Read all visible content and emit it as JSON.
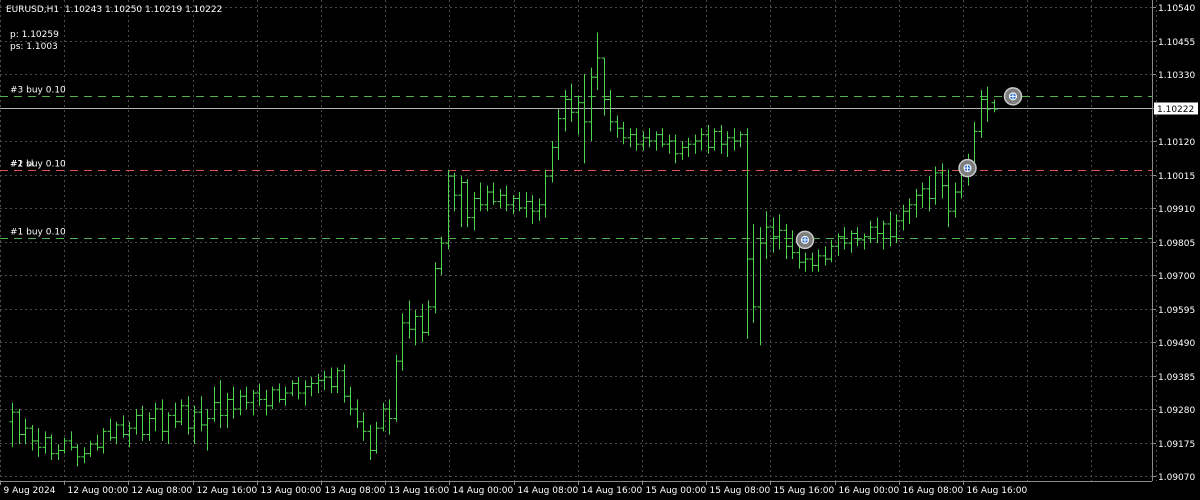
{
  "header": {
    "symbol_timeframe": "EURUSD,H1",
    "ohlc": "1.10243 1.10250 1.10219 1.10222",
    "p_line": "p: 1.10259",
    "ps_line": "ps: 1.1003"
  },
  "price_axis": {
    "labels": [
      "1.10540",
      "1.10455",
      "1.10330",
      "1.10222",
      "1.10120",
      "1.10015",
      "1.09910",
      "1.09805",
      "1.09700",
      "1.09595",
      "1.09490",
      "1.09385",
      "1.09280",
      "1.09175",
      "1.09070"
    ],
    "current_price": "1.10222"
  },
  "time_axis": {
    "labels": [
      "9 Aug 2024",
      "12 Aug 00:00",
      "12 Aug 08:00",
      "12 Aug 16:00",
      "13 Aug 00:00",
      "13 Aug 08:00",
      "13 Aug 16:00",
      "14 Aug 00:00",
      "14 Aug 08:00",
      "14 Aug 16:00",
      "15 Aug 00:00",
      "15 Aug 08:00",
      "15 Aug 16:00",
      "16 Aug 00:00",
      "16 Aug 08:00",
      "16 Aug 16:00"
    ]
  },
  "orders": [
    {
      "label": "#3 buy 0.10",
      "price": 1.1026,
      "color": "#4fb24f"
    },
    {
      "label": "#2 buy 0.10",
      "price": 1.1003,
      "color": "#d9534f"
    },
    {
      "label": "#1 buy 0.10",
      "price": 1.09815,
      "color": "#4fb24f"
    }
  ],
  "order_overlap_label": "#1 sl",
  "bid_line_color": "#b0b0b0",
  "colors": {
    "background": "#000000",
    "grid": "#4a4a4a",
    "bar": "#4fd64f",
    "text": "#ffffff",
    "price_tag_bg": "#ffffff",
    "price_tag_text": "#000000"
  },
  "chart_data": {
    "type": "ohlc",
    "symbol": "EURUSD",
    "timeframe": "H1",
    "ylim": [
      1.0907,
      1.1054
    ],
    "grid": true,
    "entries": [
      {
        "time_index": 122,
        "price": 1.0981
      },
      {
        "time_index": 147,
        "price": 1.10035
      },
      {
        "time_index": 154,
        "price": 1.1026
      }
    ],
    "bars": [
      {
        "o": 1.0924,
        "h": 1.093,
        "l": 1.0916,
        "c": 1.0927
      },
      {
        "o": 1.0927,
        "h": 1.0928,
        "l": 1.0917,
        "c": 1.092
      },
      {
        "o": 1.092,
        "h": 1.0925,
        "l": 1.0917,
        "c": 1.0922
      },
      {
        "o": 1.0922,
        "h": 1.0923,
        "l": 1.0915,
        "c": 1.0918
      },
      {
        "o": 1.0918,
        "h": 1.0922,
        "l": 1.0913,
        "c": 1.0916
      },
      {
        "o": 1.0916,
        "h": 1.0921,
        "l": 1.0914,
        "c": 1.0919
      },
      {
        "o": 1.0919,
        "h": 1.092,
        "l": 1.0912,
        "c": 1.0914
      },
      {
        "o": 1.0914,
        "h": 1.0917,
        "l": 1.0912,
        "c": 1.0915
      },
      {
        "o": 1.0915,
        "h": 1.0919,
        "l": 1.0914,
        "c": 1.0918
      },
      {
        "o": 1.0918,
        "h": 1.0921,
        "l": 1.0915,
        "c": 1.0916
      },
      {
        "o": 1.0916,
        "h": 1.0917,
        "l": 1.091,
        "c": 1.0913
      },
      {
        "o": 1.0913,
        "h": 1.0916,
        "l": 1.0911,
        "c": 1.0914
      },
      {
        "o": 1.0914,
        "h": 1.0918,
        "l": 1.0913,
        "c": 1.0917
      },
      {
        "o": 1.0917,
        "h": 1.092,
        "l": 1.0915,
        "c": 1.0916
      },
      {
        "o": 1.0916,
        "h": 1.0922,
        "l": 1.0914,
        "c": 1.0921
      },
      {
        "o": 1.0921,
        "h": 1.0925,
        "l": 1.0918,
        "c": 1.0919
      },
      {
        "o": 1.0919,
        "h": 1.0924,
        "l": 1.0917,
        "c": 1.0923
      },
      {
        "o": 1.0923,
        "h": 1.0926,
        "l": 1.0919,
        "c": 1.092
      },
      {
        "o": 1.092,
        "h": 1.0924,
        "l": 1.0916,
        "c": 1.0922
      },
      {
        "o": 1.0922,
        "h": 1.0928,
        "l": 1.092,
        "c": 1.0926
      },
      {
        "o": 1.0926,
        "h": 1.0929,
        "l": 1.0918,
        "c": 1.092
      },
      {
        "o": 1.092,
        "h": 1.0927,
        "l": 1.0918,
        "c": 1.0925
      },
      {
        "o": 1.0925,
        "h": 1.093,
        "l": 1.0921,
        "c": 1.0928
      },
      {
        "o": 1.0928,
        "h": 1.0931,
        "l": 1.0918,
        "c": 1.0921
      },
      {
        "o": 1.0921,
        "h": 1.0927,
        "l": 1.0917,
        "c": 1.0926
      },
      {
        "o": 1.0926,
        "h": 1.093,
        "l": 1.0922,
        "c": 1.0924
      },
      {
        "o": 1.0924,
        "h": 1.0931,
        "l": 1.0923,
        "c": 1.0929
      },
      {
        "o": 1.0929,
        "h": 1.0932,
        "l": 1.092,
        "c": 1.0922
      },
      {
        "o": 1.0922,
        "h": 1.0929,
        "l": 1.0917,
        "c": 1.0927
      },
      {
        "o": 1.0927,
        "h": 1.0932,
        "l": 1.0921,
        "c": 1.0923
      },
      {
        "o": 1.0923,
        "h": 1.0928,
        "l": 1.0915,
        "c": 1.0925
      },
      {
        "o": 1.0925,
        "h": 1.0935,
        "l": 1.0924,
        "c": 1.093
      },
      {
        "o": 1.093,
        "h": 1.0937,
        "l": 1.0922,
        "c": 1.0926
      },
      {
        "o": 1.0926,
        "h": 1.0933,
        "l": 1.0922,
        "c": 1.0931
      },
      {
        "o": 1.0931,
        "h": 1.0935,
        "l": 1.0925,
        "c": 1.0928
      },
      {
        "o": 1.0928,
        "h": 1.0934,
        "l": 1.0926,
        "c": 1.0932
      },
      {
        "o": 1.0932,
        "h": 1.0935,
        "l": 1.0928,
        "c": 1.093
      },
      {
        "o": 1.093,
        "h": 1.0934,
        "l": 1.0926,
        "c": 1.0933
      },
      {
        "o": 1.0933,
        "h": 1.0936,
        "l": 1.0929,
        "c": 1.0931
      },
      {
        "o": 1.0931,
        "h": 1.0934,
        "l": 1.0926,
        "c": 1.0929
      },
      {
        "o": 1.0929,
        "h": 1.0935,
        "l": 1.0928,
        "c": 1.0934
      },
      {
        "o": 1.0934,
        "h": 1.0936,
        "l": 1.093,
        "c": 1.0931
      },
      {
        "o": 1.0931,
        "h": 1.0935,
        "l": 1.0929,
        "c": 1.0933
      },
      {
        "o": 1.0933,
        "h": 1.0937,
        "l": 1.0932,
        "c": 1.0936
      },
      {
        "o": 1.0936,
        "h": 1.0938,
        "l": 1.0931,
        "c": 1.0933
      },
      {
        "o": 1.0933,
        "h": 1.0937,
        "l": 1.0929,
        "c": 1.0935
      },
      {
        "o": 1.0935,
        "h": 1.0938,
        "l": 1.0932,
        "c": 1.0936
      },
      {
        "o": 1.0936,
        "h": 1.0939,
        "l": 1.0933,
        "c": 1.0937
      },
      {
        "o": 1.0937,
        "h": 1.094,
        "l": 1.0934,
        "c": 1.0938
      },
      {
        "o": 1.0938,
        "h": 1.0941,
        "l": 1.0933,
        "c": 1.0935
      },
      {
        "o": 1.0935,
        "h": 1.0941,
        "l": 1.0933,
        "c": 1.094
      },
      {
        "o": 1.094,
        "h": 1.0942,
        "l": 1.093,
        "c": 1.0932
      },
      {
        "o": 1.0932,
        "h": 1.0935,
        "l": 1.0926,
        "c": 1.0928
      },
      {
        "o": 1.0928,
        "h": 1.0931,
        "l": 1.0922,
        "c": 1.0924
      },
      {
        "o": 1.0924,
        "h": 1.0927,
        "l": 1.0918,
        "c": 1.0921
      },
      {
        "o": 1.0921,
        "h": 1.0923,
        "l": 1.0912,
        "c": 1.0915
      },
      {
        "o": 1.0915,
        "h": 1.0924,
        "l": 1.0914,
        "c": 1.0922
      },
      {
        "o": 1.0922,
        "h": 1.093,
        "l": 1.0921,
        "c": 1.0928
      },
      {
        "o": 1.0928,
        "h": 1.0931,
        "l": 1.092,
        "c": 1.0925
      },
      {
        "o": 1.0925,
        "h": 1.0945,
        "l": 1.0924,
        "c": 1.0943
      },
      {
        "o": 1.0943,
        "h": 1.0958,
        "l": 1.094,
        "c": 1.0955
      },
      {
        "o": 1.0955,
        "h": 1.0962,
        "l": 1.095,
        "c": 1.0953
      },
      {
        "o": 1.0953,
        "h": 1.0959,
        "l": 1.0948,
        "c": 1.0957
      },
      {
        "o": 1.0957,
        "h": 1.0961,
        "l": 1.0949,
        "c": 1.0952
      },
      {
        "o": 1.0952,
        "h": 1.0962,
        "l": 1.0951,
        "c": 1.096
      },
      {
        "o": 1.096,
        "h": 1.0974,
        "l": 1.0958,
        "c": 1.0972
      },
      {
        "o": 1.0972,
        "h": 1.0982,
        "l": 1.097,
        "c": 1.098
      },
      {
        "o": 1.098,
        "h": 1.1003,
        "l": 1.0978,
        "c": 1.1001
      },
      {
        "o": 1.1001,
        "h": 1.1002,
        "l": 1.099,
        "c": 1.0995
      },
      {
        "o": 1.0995,
        "h": 1.1001,
        "l": 1.0985,
        "c": 1.0999
      },
      {
        "o": 1.0999,
        "h": 1.1,
        "l": 1.0985,
        "c": 1.0988
      },
      {
        "o": 1.0988,
        "h": 1.0996,
        "l": 1.0984,
        "c": 1.0994
      },
      {
        "o": 1.0994,
        "h": 1.0999,
        "l": 1.099,
        "c": 1.0992
      },
      {
        "o": 1.0992,
        "h": 1.0998,
        "l": 1.099,
        "c": 1.0996
      },
      {
        "o": 1.0996,
        "h": 1.0999,
        "l": 1.0992,
        "c": 1.0993
      },
      {
        "o": 1.0993,
        "h": 1.0997,
        "l": 1.0991,
        "c": 1.0995
      },
      {
        "o": 1.0995,
        "h": 1.0998,
        "l": 1.099,
        "c": 1.0992
      },
      {
        "o": 1.0992,
        "h": 1.0995,
        "l": 1.0989,
        "c": 1.0994
      },
      {
        "o": 1.0994,
        "h": 1.0996,
        "l": 1.099,
        "c": 1.0991
      },
      {
        "o": 1.0991,
        "h": 1.0996,
        "l": 1.0988,
        "c": 1.0993
      },
      {
        "o": 1.0993,
        "h": 1.0995,
        "l": 1.0986,
        "c": 1.099
      },
      {
        "o": 1.099,
        "h": 1.0994,
        "l": 1.0987,
        "c": 1.0992
      },
      {
        "o": 1.0992,
        "h": 1.1003,
        "l": 1.0988,
        "c": 1.1001
      },
      {
        "o": 1.1001,
        "h": 1.1012,
        "l": 1.0999,
        "c": 1.101
      },
      {
        "o": 1.101,
        "h": 1.1022,
        "l": 1.1006,
        "c": 1.1019
      },
      {
        "o": 1.1019,
        "h": 1.1028,
        "l": 1.1015,
        "c": 1.1025
      },
      {
        "o": 1.1025,
        "h": 1.103,
        "l": 1.1018,
        "c": 1.1021
      },
      {
        "o": 1.1021,
        "h": 1.1026,
        "l": 1.1014,
        "c": 1.1024
      },
      {
        "o": 1.1024,
        "h": 1.1033,
        "l": 1.1005,
        "c": 1.1018
      },
      {
        "o": 1.1018,
        "h": 1.1035,
        "l": 1.1012,
        "c": 1.1032
      },
      {
        "o": 1.1032,
        "h": 1.1046,
        "l": 1.1028,
        "c": 1.1038
      },
      {
        "o": 1.1038,
        "h": 1.1038,
        "l": 1.102,
        "c": 1.1025
      },
      {
        "o": 1.1025,
        "h": 1.1028,
        "l": 1.1015,
        "c": 1.1018
      },
      {
        "o": 1.1018,
        "h": 1.102,
        "l": 1.1013,
        "c": 1.1016
      },
      {
        "o": 1.1016,
        "h": 1.1018,
        "l": 1.1011,
        "c": 1.1013
      },
      {
        "o": 1.1013,
        "h": 1.1016,
        "l": 1.101,
        "c": 1.1014
      },
      {
        "o": 1.1014,
        "h": 1.1016,
        "l": 1.1009,
        "c": 1.1011
      },
      {
        "o": 1.1011,
        "h": 1.1015,
        "l": 1.1009,
        "c": 1.1013
      },
      {
        "o": 1.1013,
        "h": 1.1016,
        "l": 1.101,
        "c": 1.1012
      },
      {
        "o": 1.1012,
        "h": 1.1015,
        "l": 1.1009,
        "c": 1.1014
      },
      {
        "o": 1.1014,
        "h": 1.1016,
        "l": 1.101,
        "c": 1.1011
      },
      {
        "o": 1.1011,
        "h": 1.1014,
        "l": 1.1008,
        "c": 1.1012
      },
      {
        "o": 1.1012,
        "h": 1.1014,
        "l": 1.1005,
        "c": 1.1008
      },
      {
        "o": 1.1008,
        "h": 1.1012,
        "l": 1.1006,
        "c": 1.101
      },
      {
        "o": 1.101,
        "h": 1.1013,
        "l": 1.1007,
        "c": 1.1011
      },
      {
        "o": 1.1011,
        "h": 1.1014,
        "l": 1.1008,
        "c": 1.1012
      },
      {
        "o": 1.1012,
        "h": 1.1016,
        "l": 1.1009,
        "c": 1.1014
      },
      {
        "o": 1.1014,
        "h": 1.1017,
        "l": 1.1008,
        "c": 1.101
      },
      {
        "o": 1.101,
        "h": 1.1016,
        "l": 1.1009,
        "c": 1.1015
      },
      {
        "o": 1.1015,
        "h": 1.1017,
        "l": 1.1008,
        "c": 1.1011
      },
      {
        "o": 1.1011,
        "h": 1.1015,
        "l": 1.1007,
        "c": 1.1013
      },
      {
        "o": 1.1013,
        "h": 1.1016,
        "l": 1.1009,
        "c": 1.1012
      },
      {
        "o": 1.1012,
        "h": 1.1015,
        "l": 1.101,
        "c": 1.1014
      },
      {
        "o": 1.1014,
        "h": 1.1016,
        "l": 1.095,
        "c": 1.0975
      },
      {
        "o": 1.0975,
        "h": 1.0986,
        "l": 1.0955,
        "c": 1.096
      },
      {
        "o": 1.096,
        "h": 1.0985,
        "l": 1.0948,
        "c": 1.098
      },
      {
        "o": 1.098,
        "h": 1.099,
        "l": 1.0975,
        "c": 1.0985
      },
      {
        "o": 1.0985,
        "h": 1.0988,
        "l": 1.0977,
        "c": 1.0982
      },
      {
        "o": 1.0982,
        "h": 1.0989,
        "l": 1.0978,
        "c": 1.0984
      },
      {
        "o": 1.0984,
        "h": 1.0986,
        "l": 1.0975,
        "c": 1.0979
      },
      {
        "o": 1.0979,
        "h": 1.0984,
        "l": 1.0975,
        "c": 1.0977
      },
      {
        "o": 1.0977,
        "h": 1.098,
        "l": 1.0972,
        "c": 1.0974
      },
      {
        "o": 1.0974,
        "h": 1.0977,
        "l": 1.0971,
        "c": 1.0975
      },
      {
        "o": 1.0975,
        "h": 1.0977,
        "l": 1.0971,
        "c": 1.0973
      },
      {
        "o": 1.0973,
        "h": 1.0978,
        "l": 1.0971,
        "c": 1.0976
      },
      {
        "o": 1.0976,
        "h": 1.0979,
        "l": 1.0973,
        "c": 1.0975
      },
      {
        "o": 1.0975,
        "h": 1.0981,
        "l": 1.0974,
        "c": 1.0979
      },
      {
        "o": 1.0979,
        "h": 1.0983,
        "l": 1.0976,
        "c": 1.0982
      },
      {
        "o": 1.0982,
        "h": 1.0985,
        "l": 1.0978,
        "c": 1.098
      },
      {
        "o": 1.098,
        "h": 1.0984,
        "l": 1.0977,
        "c": 1.0983
      },
      {
        "o": 1.0983,
        "h": 1.0985,
        "l": 1.0979,
        "c": 1.0981
      },
      {
        "o": 1.0981,
        "h": 1.0983,
        "l": 1.0978,
        "c": 1.0982
      },
      {
        "o": 1.0982,
        "h": 1.0987,
        "l": 1.098,
        "c": 1.0985
      },
      {
        "o": 1.0985,
        "h": 1.0988,
        "l": 1.098,
        "c": 1.0983
      },
      {
        "o": 1.0983,
        "h": 1.0987,
        "l": 1.0978,
        "c": 1.0986
      },
      {
        "o": 1.0986,
        "h": 1.099,
        "l": 1.0979,
        "c": 1.0982
      },
      {
        "o": 1.0982,
        "h": 1.0989,
        "l": 1.098,
        "c": 1.0987
      },
      {
        "o": 1.0987,
        "h": 1.0992,
        "l": 1.0984,
        "c": 1.099
      },
      {
        "o": 1.099,
        "h": 1.0994,
        "l": 1.0986,
        "c": 1.0992
      },
      {
        "o": 1.0992,
        "h": 1.0997,
        "l": 1.0988,
        "c": 1.0995
      },
      {
        "o": 1.0995,
        "h": 1.0999,
        "l": 1.0991,
        "c": 1.0997
      },
      {
        "o": 1.0997,
        "h": 1.1001,
        "l": 1.099,
        "c": 1.0994
      },
      {
        "o": 1.0994,
        "h": 1.1004,
        "l": 1.0992,
        "c": 1.1002
      },
      {
        "o": 1.1002,
        "h": 1.1005,
        "l": 1.0994,
        "c": 1.0998
      },
      {
        "o": 1.0998,
        "h": 1.1003,
        "l": 1.0985,
        "c": 1.099
      },
      {
        "o": 1.099,
        "h": 1.0999,
        "l": 1.0988,
        "c": 1.0996
      },
      {
        "o": 1.0996,
        "h": 1.1004,
        "l": 1.0994,
        "c": 1.1002
      },
      {
        "o": 1.1002,
        "h": 1.1008,
        "l": 1.0998,
        "c": 1.1005
      },
      {
        "o": 1.1005,
        "h": 1.1018,
        "l": 1.1003,
        "c": 1.1015
      },
      {
        "o": 1.1015,
        "h": 1.1028,
        "l": 1.1013,
        "c": 1.1025
      },
      {
        "o": 1.1025,
        "h": 1.1029,
        "l": 1.1018,
        "c": 1.1022
      },
      {
        "o": 1.1024,
        "h": 1.1025,
        "l": 1.1021,
        "c": 1.1022
      }
    ]
  }
}
